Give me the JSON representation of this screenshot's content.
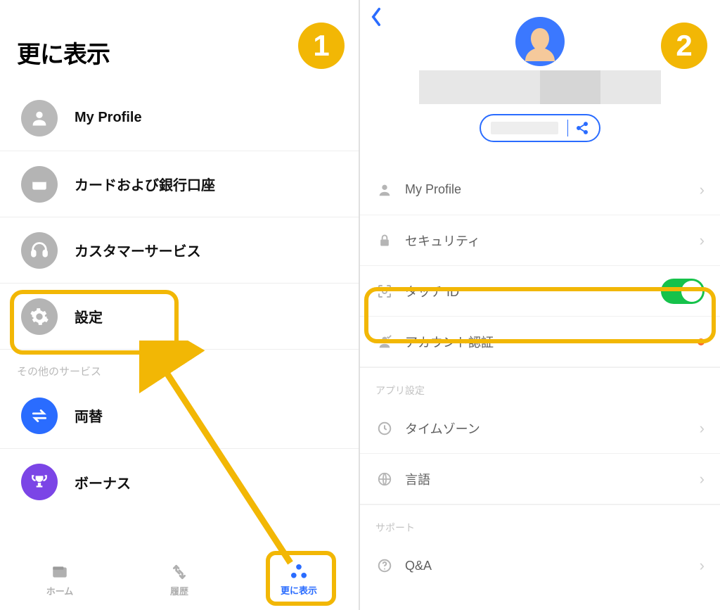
{
  "step_badges": {
    "one": "1",
    "two": "2"
  },
  "left": {
    "title": "更に表示",
    "items": [
      {
        "label": "My Profile",
        "icon": "person",
        "bg": "#b9b9b9"
      },
      {
        "label": "カードおよび銀行口座",
        "icon": "wallet",
        "bg": "#b4b4b4"
      },
      {
        "label": "カスタマーサービス",
        "icon": "headset",
        "bg": "#b4b4b4"
      },
      {
        "label": "設定",
        "icon": "gear",
        "bg": "#b4b4b4"
      }
    ],
    "other_section": "その他のサービス",
    "other_items": [
      {
        "label": "両替",
        "icon": "exchange",
        "bg": "#2a6cff"
      },
      {
        "label": "ボーナス",
        "icon": "trophy",
        "bg": "#7b45e6"
      }
    ],
    "tabs": [
      {
        "label": "ホーム",
        "icon": "wallet-tab"
      },
      {
        "label": "履歴",
        "icon": "history-tab"
      },
      {
        "label": "更に表示",
        "icon": "more-tab",
        "active": true
      }
    ]
  },
  "right": {
    "sections": [
      {
        "items": [
          {
            "label": "My Profile",
            "icon": "person",
            "trailing": "chevron"
          },
          {
            "label": "セキュリティ",
            "icon": "lock",
            "trailing": "chevron"
          },
          {
            "label": "タッチ ID",
            "icon": "touchid",
            "trailing": "toggle-on"
          },
          {
            "label": "アカウント認証",
            "icon": "verify",
            "trailing": "dot"
          }
        ]
      },
      {
        "title": "アプリ設定",
        "items": [
          {
            "label": "タイムゾーン",
            "icon": "clock",
            "trailing": "chevron"
          },
          {
            "label": "言語",
            "icon": "globe",
            "trailing": "chevron"
          }
        ]
      },
      {
        "title": "サポート",
        "items": [
          {
            "label": "Q&A",
            "icon": "help",
            "trailing": "chevron"
          }
        ]
      }
    ]
  }
}
